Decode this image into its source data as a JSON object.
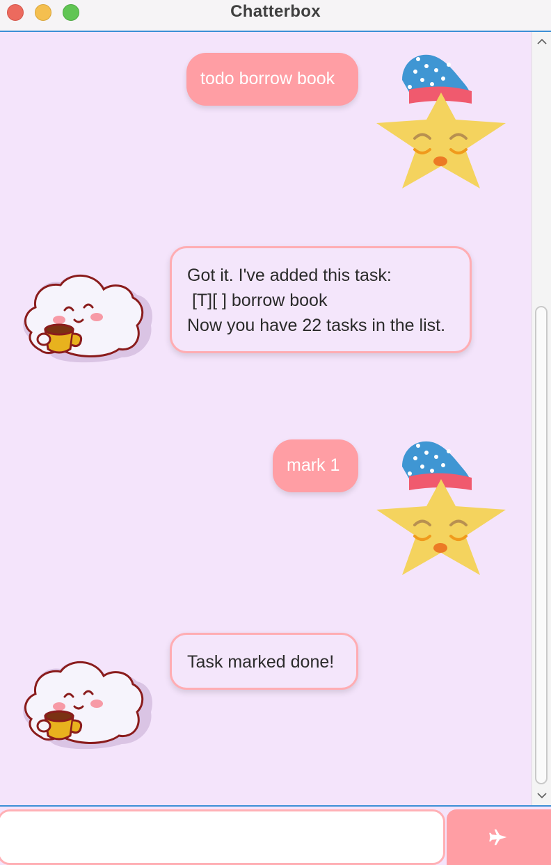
{
  "window": {
    "title": "Chatterbox"
  },
  "messages": [
    {
      "sender": "user",
      "text": "todo borrow book"
    },
    {
      "sender": "bot",
      "text": "Got it. I've added this task:\n [T][ ] borrow book\nNow you have 22 tasks in the list."
    },
    {
      "sender": "user",
      "text": "mark 1"
    },
    {
      "sender": "bot",
      "text": "Task marked done!"
    }
  ],
  "input": {
    "value": "",
    "placeholder": ""
  },
  "send_button": {
    "icon": "paper-plane-icon"
  },
  "colors": {
    "background": "#f4e4fb",
    "user_bubble": "#ff9ea4",
    "bot_bubble_border": "#ffadb3",
    "accent_border": "#3b8fd6"
  }
}
